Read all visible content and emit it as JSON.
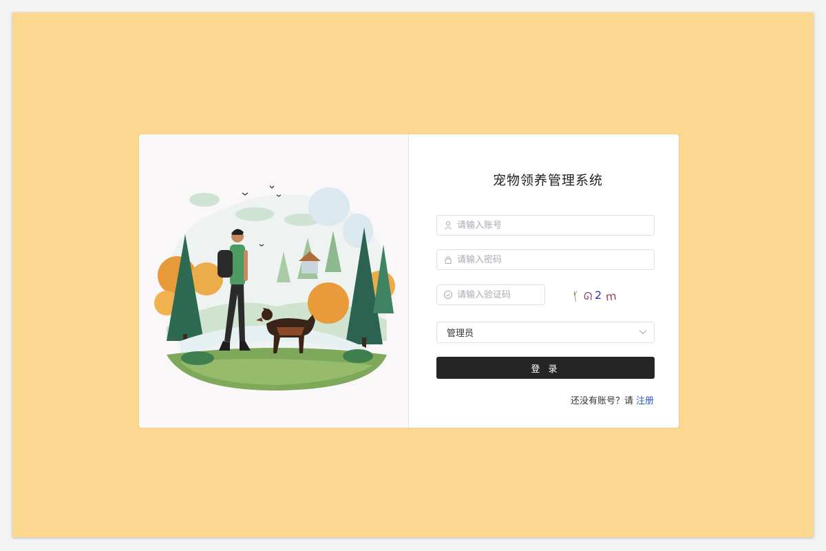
{
  "login": {
    "title": "宠物领养管理系统",
    "username_placeholder": "请输入账号",
    "password_placeholder": "请输入密码",
    "captcha_placeholder": "请输入验证码",
    "captcha_text": "Ҁ ㄈ2 ㄇ",
    "role_selected": "管理员",
    "login_button": "登 录",
    "register_prompt": "还没有账号？请",
    "register_link": "注册"
  },
  "icons": {
    "username": "user-icon",
    "password": "lock-icon",
    "captcha": "check-circle-icon",
    "select": "chevron-down-icon"
  },
  "colors": {
    "background": "#fbd78f",
    "button": "#252525",
    "link": "#2c56c8"
  }
}
